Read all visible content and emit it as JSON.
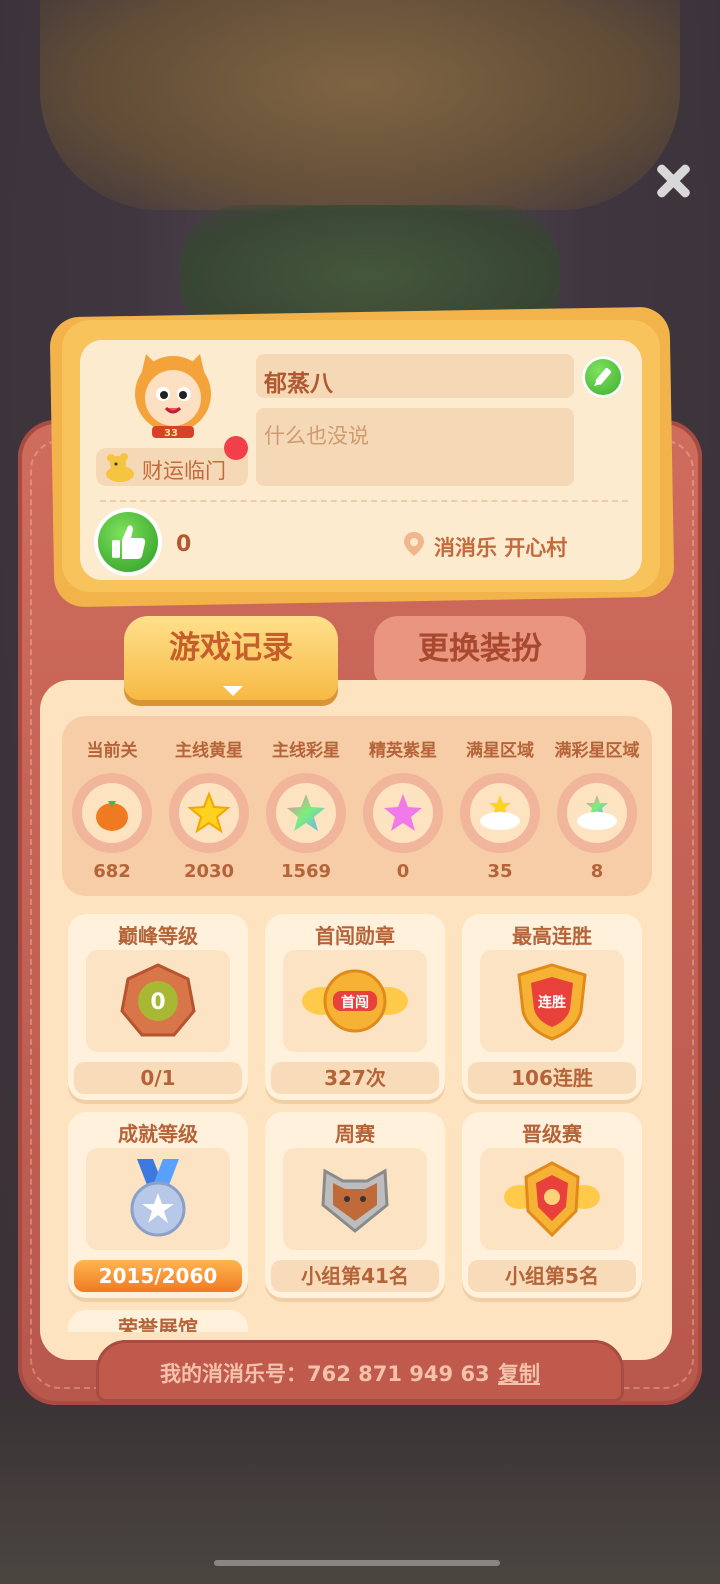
{
  "profile": {
    "name": "郁蒸八",
    "motto": "什么也没说",
    "fortune_badge": "财运临门",
    "avatar_level": "33",
    "likes": "0",
    "location": "消消乐  开心村"
  },
  "tabs": [
    {
      "label": "游戏记录",
      "active": true
    },
    {
      "label": "更换装扮",
      "active": false
    }
  ],
  "stats": [
    {
      "label": "当前关",
      "value": "682",
      "icon": "fruit-icon"
    },
    {
      "label": "主线黄星",
      "value": "2030",
      "icon": "yellow-star-icon"
    },
    {
      "label": "主线彩星",
      "value": "1569",
      "icon": "rainbow-star-icon"
    },
    {
      "label": "精英紫星",
      "value": "0",
      "icon": "purple-star-icon"
    },
    {
      "label": "满星区域",
      "value": "35",
      "icon": "star-cloud-icon"
    },
    {
      "label": "满彩星区域",
      "value": "8",
      "icon": "rainbow-cloud-icon"
    }
  ],
  "tiles": [
    {
      "title": "巅峰等级",
      "value": "0/1",
      "icon": "peak-level-badge-icon",
      "badge_text": "0"
    },
    {
      "title": "首闯勋章",
      "value": "327次",
      "icon": "first-clear-medal-icon",
      "badge_text": "首闯"
    },
    {
      "title": "最高连胜",
      "value": "106连胜",
      "icon": "win-streak-shield-icon",
      "badge_text": "连胜"
    },
    {
      "title": "成就等级",
      "value": "2015/2060",
      "icon": "achievement-medal-icon",
      "progress": 0.978
    },
    {
      "title": "周赛",
      "value": "小组第41名",
      "icon": "weekly-cat-badge-icon"
    },
    {
      "title": "晋级赛",
      "value": "小组第5名",
      "icon": "promotion-badge-icon"
    }
  ],
  "partial_tile": {
    "title": "荣誉展馆"
  },
  "footer": {
    "id_text": "我的消消乐号：762 871 949 63",
    "copy_label": "复制"
  },
  "colors": {
    "accent": "#c65e2b",
    "wallet": "#c9685a",
    "panel": "#fde3bf"
  }
}
